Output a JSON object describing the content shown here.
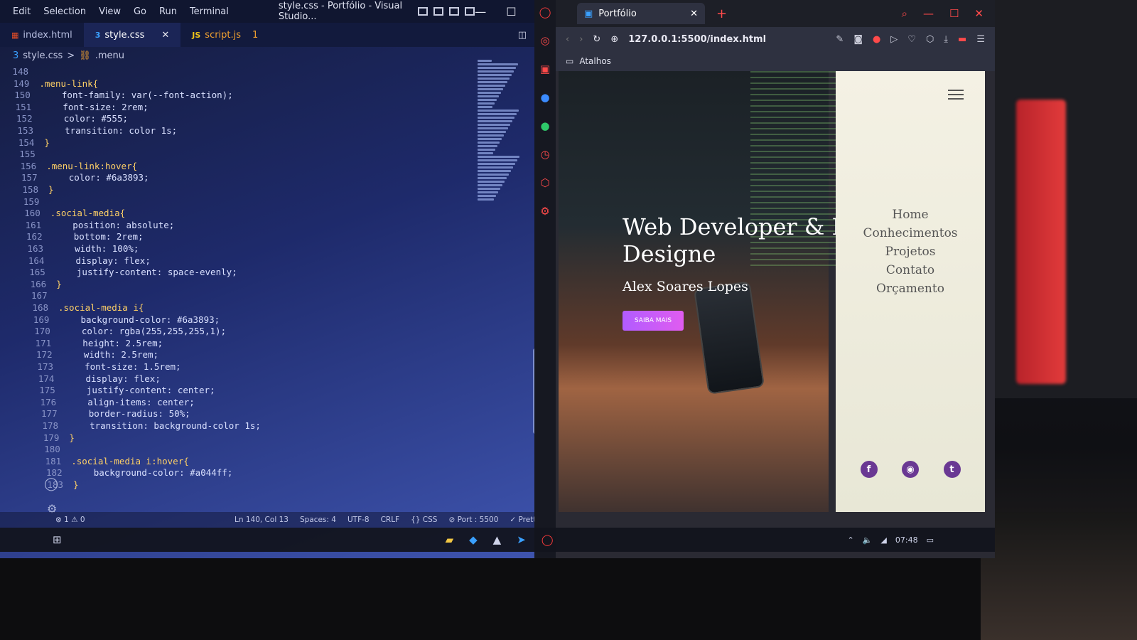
{
  "vscode": {
    "menu": [
      "Edit",
      "Selection",
      "View",
      "Go",
      "Run",
      "Terminal"
    ],
    "window_title": "style.css - Portfólio - Visual Studio...",
    "tabs": [
      {
        "label": "index.html",
        "icon": "html-file-icon"
      },
      {
        "label": "style.css",
        "icon": "css-file-icon",
        "close": "✕"
      },
      {
        "label": "script.js",
        "icon": "js-file-icon",
        "errors": "1"
      }
    ],
    "icon_labels": {
      "css": "3",
      "js": "JS"
    },
    "breadcrumb": {
      "file": "style.css",
      "sep": ">",
      "symbol": ".menu"
    },
    "code": [
      {
        "n": "148",
        "t": ""
      },
      {
        "n": "149",
        "t": ".menu-link{"
      },
      {
        "n": "150",
        "t": "    font-family: var(--font-action);"
      },
      {
        "n": "151",
        "t": "    font-size: 2rem;"
      },
      {
        "n": "152",
        "t": "    color: #555;"
      },
      {
        "n": "153",
        "t": "    transition: color 1s;"
      },
      {
        "n": "154",
        "t": "}"
      },
      {
        "n": "155",
        "t": ""
      },
      {
        "n": "156",
        "t": ".menu-link:hover{"
      },
      {
        "n": "157",
        "t": "    color: #6a3893;"
      },
      {
        "n": "158",
        "t": "}"
      },
      {
        "n": "159",
        "t": ""
      },
      {
        "n": "160",
        "t": ".social-media{"
      },
      {
        "n": "161",
        "t": "    position: absolute;"
      },
      {
        "n": "162",
        "t": "    bottom: 2rem;"
      },
      {
        "n": "163",
        "t": "    width: 100%;"
      },
      {
        "n": "164",
        "t": "    display: flex;"
      },
      {
        "n": "165",
        "t": "    justify-content: space-evenly;"
      },
      {
        "n": "166",
        "t": "}"
      },
      {
        "n": "167",
        "t": ""
      },
      {
        "n": "168",
        "t": ".social-media i{"
      },
      {
        "n": "169",
        "t": "    background-color: #6a3893;"
      },
      {
        "n": "170",
        "t": "    color: rgba(255,255,255,1);"
      },
      {
        "n": "171",
        "t": "    height: 2.5rem;"
      },
      {
        "n": "172",
        "t": "    width: 2.5rem;"
      },
      {
        "n": "173",
        "t": "    font-size: 1.5rem;"
      },
      {
        "n": "174",
        "t": "    display: flex;"
      },
      {
        "n": "175",
        "t": "    justify-content: center;"
      },
      {
        "n": "176",
        "t": "    align-items: center;"
      },
      {
        "n": "177",
        "t": "    border-radius: 50%;"
      },
      {
        "n": "178",
        "t": "    transition: background-color 1s;"
      },
      {
        "n": "179",
        "t": "}"
      },
      {
        "n": "180",
        "t": ""
      },
      {
        "n": "181",
        "t": ".social-media i:hover{"
      },
      {
        "n": "182",
        "t": "    background-color: #a044ff;"
      },
      {
        "n": "183",
        "t": "}"
      }
    ],
    "status": {
      "problems": "⊗ 1 ⚠ 0",
      "items": [
        "Ln 140, Col 13",
        "Spaces: 4",
        "UTF-8",
        "CRLF",
        "{} CSS",
        "⊘ Port : 5500",
        "✓ Prettier"
      ]
    },
    "colors": {
      "swatch_gray": "#555555",
      "swatch_purple": "#6a3893",
      "swatch_white": "#ffffff",
      "swatch_violet": "#a044ff"
    }
  },
  "browser": {
    "tab_title": "Portfólio",
    "tab_close": "✕",
    "new_tab": "+",
    "url": "127.0.0.1:5500/index.html",
    "bookmarks_label": "Atalhos",
    "page": {
      "hero_title": "Web Developer & F Designe",
      "hero_name": "Alex Soares Lopes",
      "hero_button": "SAIBA MAIS",
      "menu_links": [
        "Home",
        "Conhecimentos",
        "Projetos",
        "Contato",
        "Orçamento"
      ],
      "social_icons": [
        "facebook-icon",
        "discord-icon",
        "twitter-icon"
      ],
      "social_glyphs": [
        "f",
        "◉",
        "t"
      ],
      "accent_color": "#6a3893",
      "button_color": "#b15cff"
    }
  },
  "taskbar": {
    "time": "07:48"
  }
}
